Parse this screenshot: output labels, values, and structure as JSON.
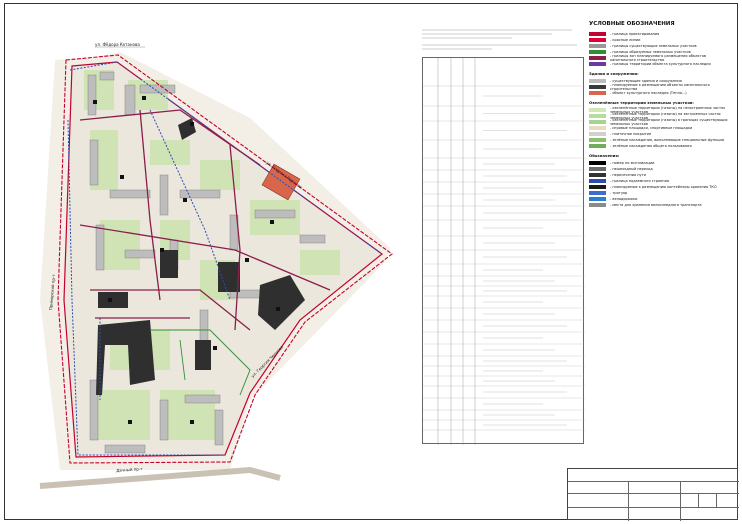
{
  "streets": {
    "north": "ул. Фёдора Котанова",
    "east": "ул. Георгия Чернова",
    "west": "Приморский пр-т",
    "south": "Дачный пр-т"
  },
  "legend": {
    "title": "УСЛОВНЫЕ ОБОЗНАЧЕНИЯ",
    "sections": [
      {
        "title": "",
        "items": [
          {
            "label": "- граница проектирования",
            "color": "#c3002f"
          },
          {
            "label": "- красные линии",
            "color": "#e0003a"
          },
          {
            "label": "- границы существующих земельных участков",
            "color": "#9a9a9a"
          },
          {
            "label": "- границы образуемых земельных участков",
            "color": "#2f8f2f"
          },
          {
            "label": "- границы зон планируемого размещения объектов капитального строительства",
            "color": "#8b1e4a"
          },
          {
            "label": "- границы территории объекта культурного наследия",
            "color": "#6b3aa0"
          }
        ]
      },
      {
        "title": "Здания и сооружения:",
        "items": [
          {
            "label": "- существующие здания и сооружения",
            "color": "#bdbdbd"
          },
          {
            "label": "- планируемые к размещению объекты капитального строительства",
            "color": "#3a3a3a"
          },
          {
            "label": "- объект культурного наследия (Тепло...)",
            "color": "#d8664a"
          }
        ]
      },
      {
        "title": "Озеленённые территории земельных участков:",
        "items": [
          {
            "label": "- озеленённые территории (газоны) на незастроенных частях земельных участков",
            "color": "#cfe8b8"
          },
          {
            "label": "- озеленённые территории (газоны) на застроенных частях земельных участков",
            "color": "#b8dca0"
          },
          {
            "label": "- озеленённые территории (газоны) в границах существующих земельных участков",
            "color": "#a6d48c"
          },
          {
            "label": "- игровые площадки, спортивные площадки",
            "color": "#e8dcc0"
          },
          {
            "label": "- плиточное покрытие",
            "color": "#d0d0d0"
          },
          {
            "label": "- зелёные насаждения, выполняющие специальные функции",
            "color": "#8cc070"
          },
          {
            "label": "- зелёные насаждения общего пользования",
            "color": "#6fae57"
          }
        ]
      },
      {
        "title": "Обозначения:",
        "items": [
          {
            "label": "- номер по экспликации",
            "color": "#000000"
          },
          {
            "label": "- пешеходный переход",
            "color": "#6a6a6a"
          },
          {
            "label": "- пересечения пути",
            "color": "#333333"
          },
          {
            "label": "- граница подземного строения",
            "color": "#2c4db0"
          },
          {
            "label": "- планируемые к размещению контейнеры хранения ТКО",
            "color": "#1a1a1a"
          },
          {
            "label": "- тротуар",
            "color": "#3a6fd0"
          },
          {
            "label": "- велодорожки",
            "color": "#2c7fd0"
          },
          {
            "label": "- места для хранения велосипедного транспорта",
            "color": "#8a8a8a"
          }
        ]
      }
    ]
  },
  "colors": {
    "block_fill": "#e9e6df",
    "road": "#f4f1ea",
    "green": "#cfe3b5",
    "dark_building": "#2f2f2f",
    "existing_building": "#b9b9b9",
    "heritage": "#d8664a",
    "boundary_red": "#c3002f",
    "zone_purple": "#8b1e4a",
    "plot_green": "#2f8f2f",
    "path_blue": "#2c4db0"
  }
}
